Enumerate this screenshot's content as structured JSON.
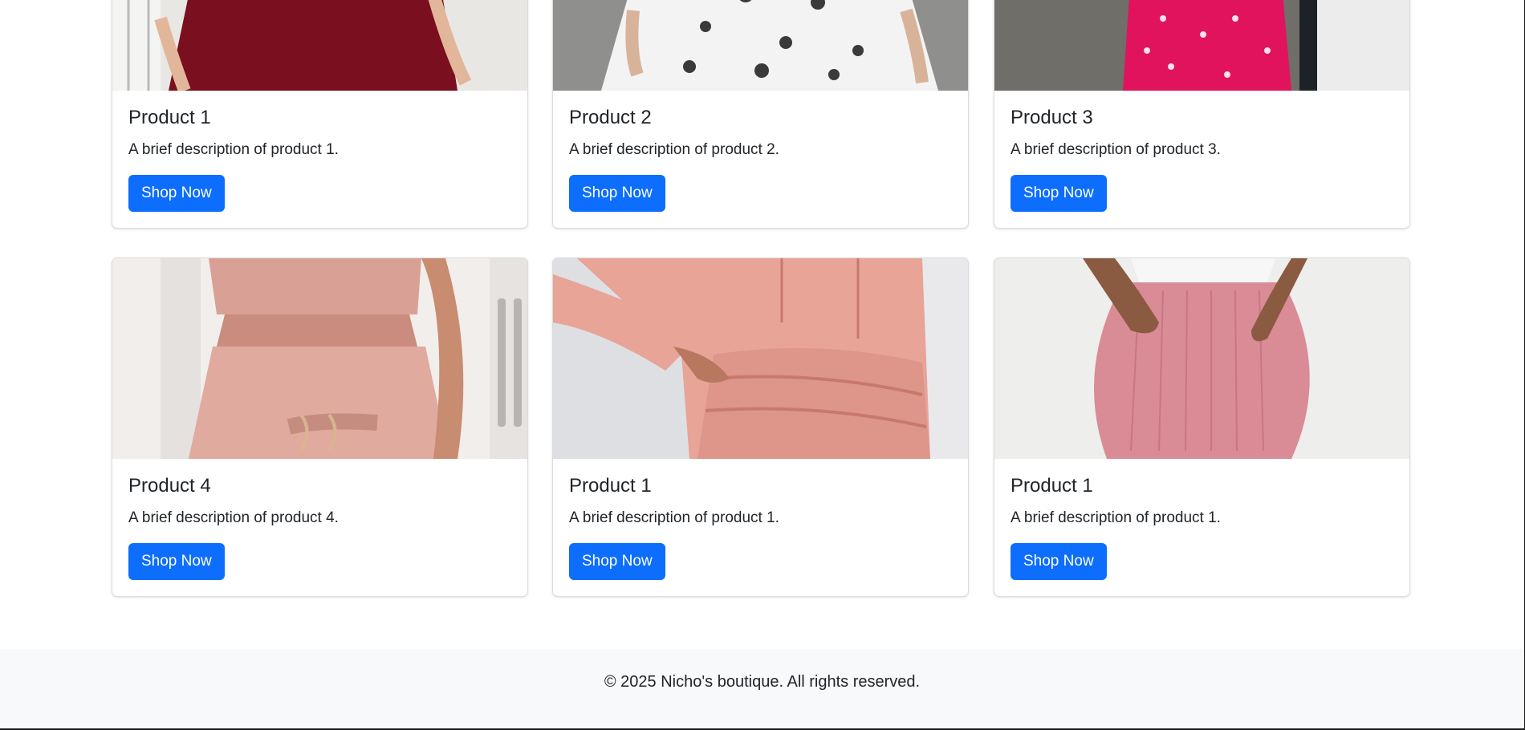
{
  "products": [
    {
      "title": "Product 1",
      "description": "A brief description of product 1.",
      "button": "Shop Now",
      "image": "burgundy-dress-photo"
    },
    {
      "title": "Product 2",
      "description": "A brief description of product 2.",
      "button": "Shop Now",
      "image": "floral-dress-photo"
    },
    {
      "title": "Product 3",
      "description": "A brief description of product 3.",
      "button": "Shop Now",
      "image": "pink-print-dress-photo"
    },
    {
      "title": "Product 4",
      "description": "A brief description of product 4.",
      "button": "Shop Now",
      "image": "pink-skirt-set-photo"
    },
    {
      "title": "Product 1",
      "description": "A brief description of product 1.",
      "button": "Shop Now",
      "image": "pink-hoodie-dress-photo"
    },
    {
      "title": "Product 1",
      "description": "A brief description of product 1.",
      "button": "Shop Now",
      "image": "pink-ribbed-dress-photo"
    }
  ],
  "footer": {
    "text": "© 2025 Nicho's boutique. All rights reserved."
  },
  "colors": {
    "primary": "#0d6efd",
    "footer_bg": "#f8f9fa",
    "text": "#212529"
  }
}
